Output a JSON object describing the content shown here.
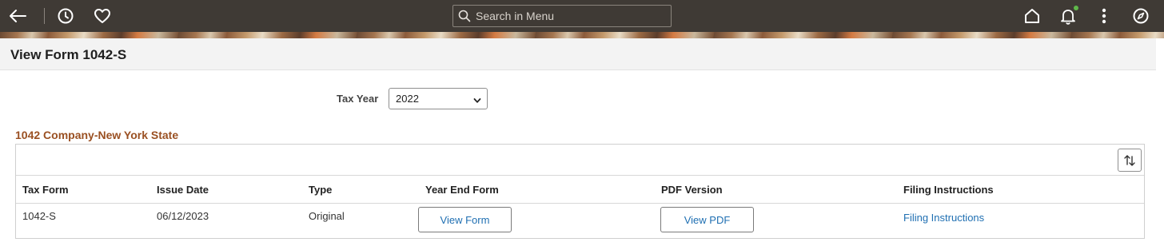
{
  "topbar": {
    "icons": {
      "back": "back-arrow-icon",
      "recent": "clock-icon",
      "favorites": "heart-icon",
      "search": "search-icon",
      "home": "home-icon",
      "notifications": "bell-icon",
      "actions": "kebab-menu-icon",
      "navigator": "compass-icon"
    },
    "search": {
      "placeholder": "Search in Menu",
      "value": ""
    },
    "notification_status_color": "#5fb84a"
  },
  "page": {
    "title": "View Form 1042-S"
  },
  "filter": {
    "tax_year_label": "Tax Year",
    "tax_year_value": "2022"
  },
  "section": {
    "title": "1042 Company-New York State",
    "columns": [
      "Tax Form",
      "Issue Date",
      "Type",
      "Year End Form",
      "PDF Version",
      "Filing Instructions"
    ],
    "rows": [
      {
        "tax_form": "1042-S",
        "issue_date": "06/12/2023",
        "type": "Original",
        "year_end_form": "View Form",
        "pdf_version": "View PDF",
        "filing_instructions": "Filing Instructions"
      }
    ]
  },
  "colors": {
    "topbar_bg": "#3f3a35",
    "section_title": "#9a5022",
    "link": "#1f6fb2"
  }
}
